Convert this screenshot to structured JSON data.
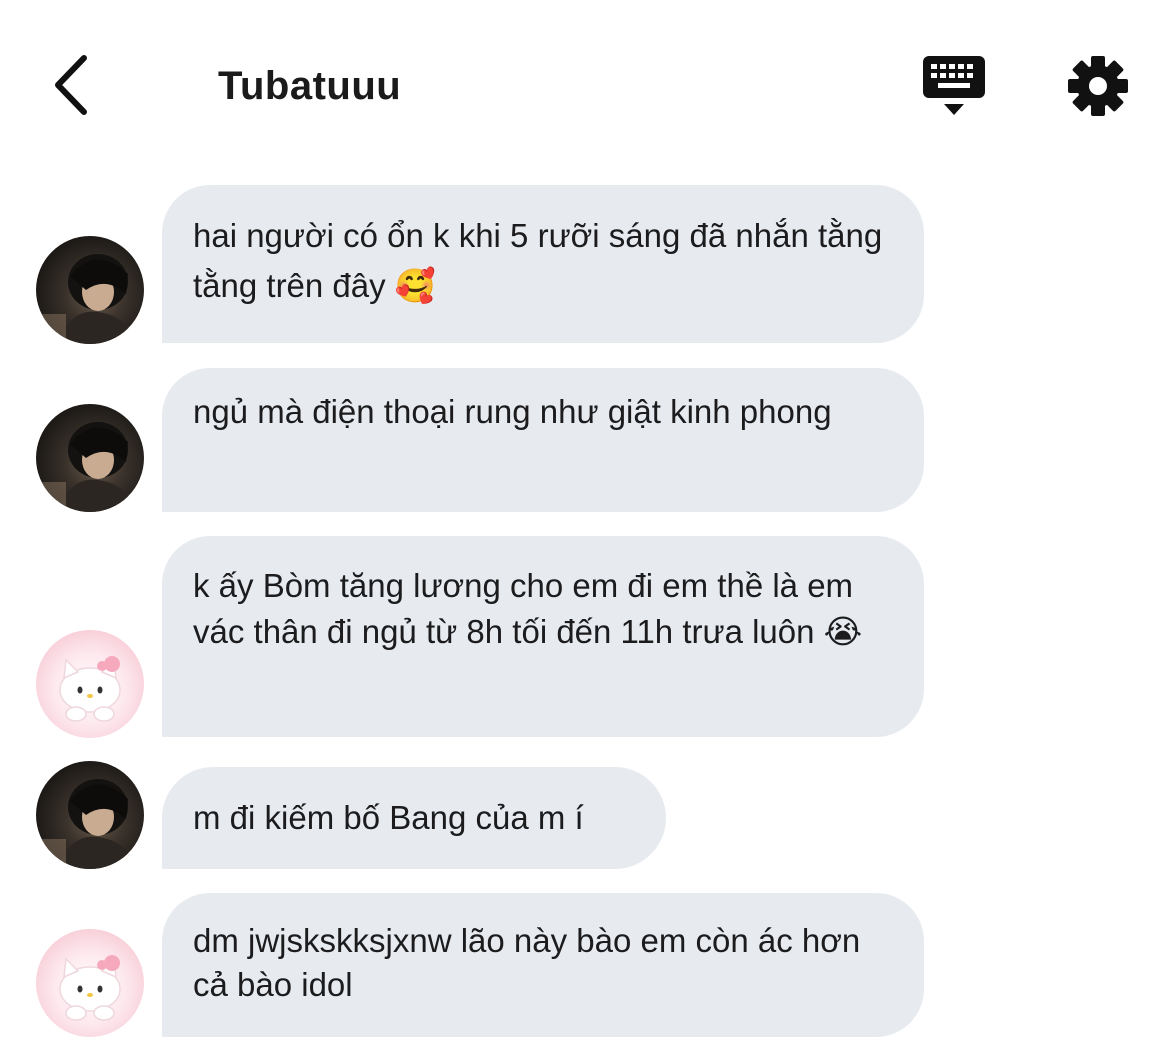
{
  "header": {
    "title": "Tubatuuu"
  },
  "icons": {
    "back": "chevron-left-icon",
    "keyboard": "keyboard-icon",
    "settings": "gear-icon"
  },
  "messages": [
    {
      "sender": "boy",
      "text": "hai người có ổn k khi 5 rưỡi sáng đã nhắn tằng tằng trên đây 🥰"
    },
    {
      "sender": "boy",
      "text": "ngủ mà điện thoại rung như giật kinh phong"
    },
    {
      "sender": "kitty",
      "text": "k ấy Bòm tăng lương cho em đi em thề là em vác thân đi ngủ từ 8h tối đến 11h trưa luôn 😭"
    },
    {
      "sender": "boy",
      "text": "m đi kiếm bố Bang của m í"
    },
    {
      "sender": "kitty",
      "text": "dm jwjskskksjxnw lão này bào em còn ác hơn cả bào idol"
    }
  ]
}
